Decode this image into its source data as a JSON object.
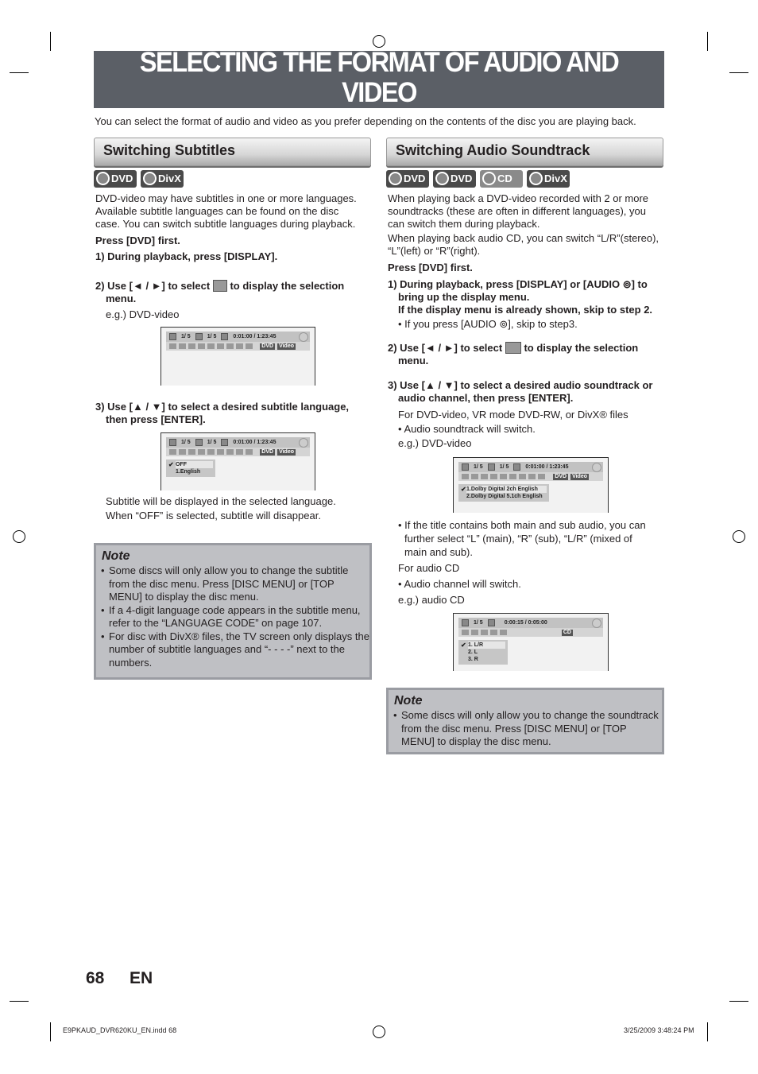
{
  "title": "SELECTING THE FORMAT OF AUDIO AND VIDEO",
  "intro": "You can select the format of audio and video as you prefer depending on the contents of the disc you are playing back.",
  "left": {
    "heading": "Switching Subtitles",
    "badges": [
      "DVD",
      "DivX"
    ],
    "para": [
      "DVD-video may have subtitles in one or more languages.",
      "Available subtitle languages can be found on the disc",
      "case. You can switch subtitle languages during playback."
    ],
    "press": "Press [DVD] first.",
    "step1": "1) During playback, press [DISPLAY].",
    "step2a": "2) Use [◄ / ►] to select",
    "step2b": "to display the selection",
    "step2c": "menu.",
    "eg": "e.g.) DVD-video",
    "step3a": "3) Use [▲ / ▼] to select a desired subtitle language,",
    "step3b": "then press [ENTER].",
    "after": [
      "Subtitle will be displayed in the selected language.",
      "When “OFF” is selected, subtitle will disappear."
    ],
    "note_title": "Note",
    "notes": [
      "Some discs will only allow you to change the subtitle from the disc menu. Press [DISC MENU] or [TOP MENU] to display the disc menu.",
      "If a 4-digit language code appears in the subtitle menu, refer to the “LANGUAGE CODE” on page 107.",
      "For disc with DivX® files, the TV screen only displays the number of subtitle languages and “- - - -” next to the numbers."
    ]
  },
  "right": {
    "heading": "Switching Audio Soundtrack",
    "badges": [
      "DVD",
      "DVD",
      "CD",
      "DivX"
    ],
    "para": [
      "When playing back a DVD-video recorded with 2 or more",
      "soundtracks (these are often in different languages), you",
      "can switch them during playback."
    ],
    "para2": [
      "When playing back audio CD, you can switch “L/R”(stereo),",
      "“L”(left) or “R”(right)."
    ],
    "press": "Press [DVD] first.",
    "step1": [
      "1) During playback, press [DISPLAY] or [AUDIO ⊚] to",
      "bring up the display menu.",
      "If the display menu is already shown, skip to step 2."
    ],
    "step1_bullet": "• If you press [AUDIO ⊚], skip to step3.",
    "step2a": "2) Use [◄ / ►] to select",
    "step2b": "to display the selection",
    "step2c": "menu.",
    "step3": [
      "3) Use [▲ / ▼] to select a desired audio soundtrack or",
      "audio channel, then press [ENTER]."
    ],
    "for_dvd": "For DVD-video, VR mode DVD-RW, or DivX® files",
    "bullet_switch": "• Audio soundtrack will switch.",
    "eg_dvd": "e.g.) DVD-video",
    "bullet_title": [
      "• If the title contains both main and sub audio, you can",
      "further select “L” (main), “R” (sub), “L/R” (mixed of",
      "main and sub)."
    ],
    "for_cd": "For audio CD",
    "bullet_channel": "• Audio channel will switch.",
    "eg_cd": "e.g.) audio CD",
    "note_title": "Note",
    "notes": [
      "Some discs will only allow you to change the soundtrack from the disc menu. Press [DISC MENU] or [TOP MENU] to display the disc menu."
    ]
  },
  "screens": {
    "track": "1/  5",
    "chapter": "1/  5",
    "time": "0:01:00 / 1:23:45",
    "dvd": "DVD",
    "video": "Video",
    "sub_options": [
      "OFF",
      "1.English"
    ],
    "audio_options": [
      "1.Dolby Digital    2ch English",
      "2.Dolby Digital  5.1ch English"
    ],
    "cd_track": "1/  5",
    "cd_time": "0:00:15 / 0:05:00",
    "cd": "CD",
    "cd_options": [
      "1. L/R",
      "2. L",
      "3. R"
    ]
  },
  "footer": {
    "page": "68",
    "lang": "EN",
    "file": "E9PKAUD_DVR620KU_EN.indd   68",
    "date": "3/25/2009   3:48:24 PM"
  }
}
